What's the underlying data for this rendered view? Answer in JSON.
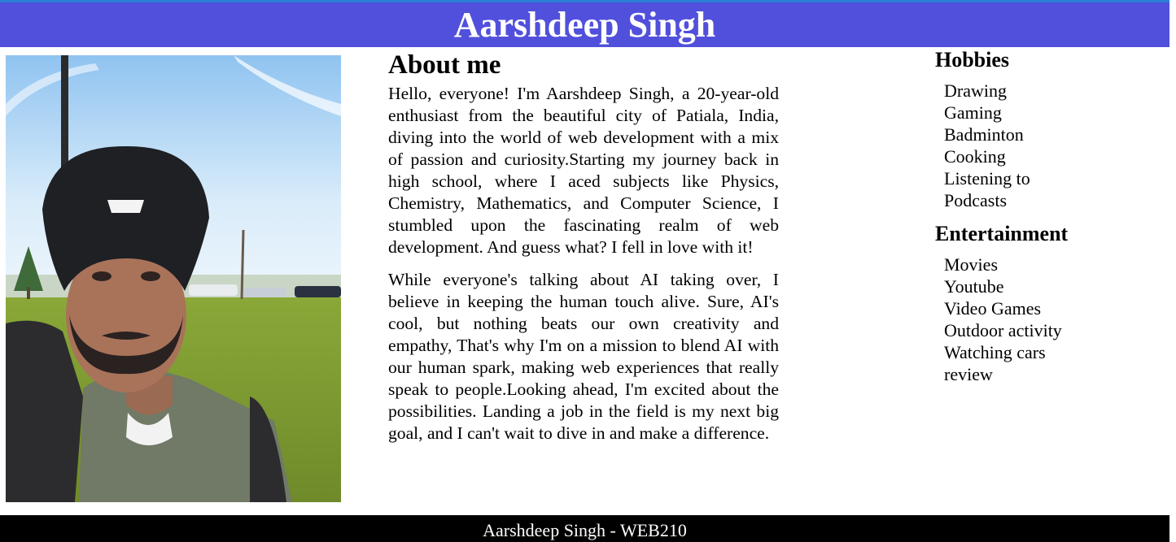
{
  "header": {
    "title": "Aarshdeep Singh"
  },
  "photo": {
    "subject": "selfie-portrait"
  },
  "about": {
    "heading": "About me",
    "paragraphs": [
      "Hello, everyone! I'm Aarshdeep Singh, a 20-year-old enthusiast from the beautiful city of Patiala, India, diving into the world of web development with a mix of passion and curiosity.Starting my journey back in high school, where I aced subjects like Physics, Chemistry, Mathematics, and Computer Science, I stumbled upon the fascinating realm of web development. And guess what? I fell in love with it!",
      "While everyone's talking about AI taking over, I believe in keeping the human touch alive. Sure, AI's cool, but nothing beats our own creativity and empathy, That's why I'm on a mission to blend AI with our human spark, making web experiences that really speak to people.Looking ahead, I'm excited about the possibilities. Landing a job in the field is my next big goal, and I can't wait to dive in and make a difference."
    ]
  },
  "hobbies": {
    "heading": "Hobbies",
    "items": [
      "Drawing",
      "Gaming",
      "Badminton",
      "Cooking",
      "Listening to Podcasts"
    ]
  },
  "entertainment": {
    "heading": "Entertainment",
    "items": [
      "Movies",
      "Youtube",
      "Video Games",
      "Outdoor activity",
      "Watching cars review"
    ]
  },
  "footer": {
    "text": "Aarshdeep Singh - WEB210"
  },
  "colors": {
    "header_bg": "#5150dc",
    "footer_bg": "#000000",
    "header_text": "#ffffff"
  }
}
